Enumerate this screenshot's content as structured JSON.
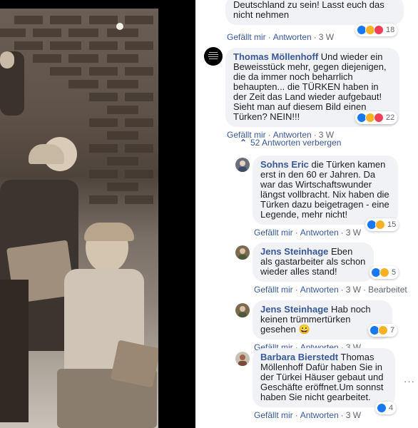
{
  "comments": [
    {
      "text": "Deutschland zu sein! Lasst euch das nicht nehmen",
      "actions": {
        "like": "Gefällt mir",
        "reply": "Antworten",
        "time": "3 W"
      },
      "reactions": {
        "count": "18",
        "types": [
          "like",
          "haha",
          "love"
        ]
      }
    },
    {
      "author": "Thomas Möllenhoff",
      "text": "Und wieder ein Beweisstück mehr, gegen diejenigen, die da immer noch beharrlich behaupten... die TÜRKEN haben in der Zeit das Land wieder aufgebaut! Sieht man auf diesem Bild einen Türken? NEIN!!!",
      "actions": {
        "like": "Gefällt mir",
        "reply": "Antworten",
        "time": "3 W"
      },
      "reactions": {
        "count": "22",
        "types": [
          "like",
          "haha",
          "love"
        ]
      }
    }
  ],
  "replies_toggle": "52 Antworten verbergen",
  "replies": [
    {
      "author": "Sohns Eric",
      "text": "die Türken kamen erst in den 60 er Jahren. Da war das Wirtschaftswunder längst vollbracht. Nix haben die Türken dazu beigetragen - eine Legende, mehr nicht!",
      "actions": {
        "like": "Gefällt mir",
        "reply": "Antworten",
        "time": "3 W"
      },
      "reactions": {
        "count": "15",
        "types": [
          "like",
          "haha"
        ]
      }
    },
    {
      "author": "Jens Steinhage",
      "text": "Eben als gastarbeiter als schon wieder alles stand!",
      "actions": {
        "like": "Gefällt mir",
        "reply": "Antworten",
        "time": "3 W",
        "edited": "Bearbeitet"
      },
      "reactions": {
        "count": "5",
        "types": [
          "like",
          "haha"
        ]
      }
    },
    {
      "author": "Jens Steinhage",
      "text": "Hab noch keinen trümmertürken gesehen 😀",
      "actions": {
        "like": "Gefällt mir",
        "reply": "Antworten",
        "time": "3 W"
      },
      "reactions": {
        "count": "7",
        "types": [
          "like",
          "haha"
        ]
      }
    },
    {
      "author": "Barbara Bierstedt",
      "text": "Thomas Möllenhoff Dafür haben Sie in der Türkei Häuser gebaut und Geschäfte eröffnet.Um sonnst haben Sie nicht gearbeitet.",
      "actions": {
        "like": "Gefällt mir",
        "reply": "Antworten",
        "time": "3 W"
      },
      "reactions": {
        "count": "4",
        "types": [
          "like"
        ]
      }
    }
  ],
  "more_options": "···"
}
